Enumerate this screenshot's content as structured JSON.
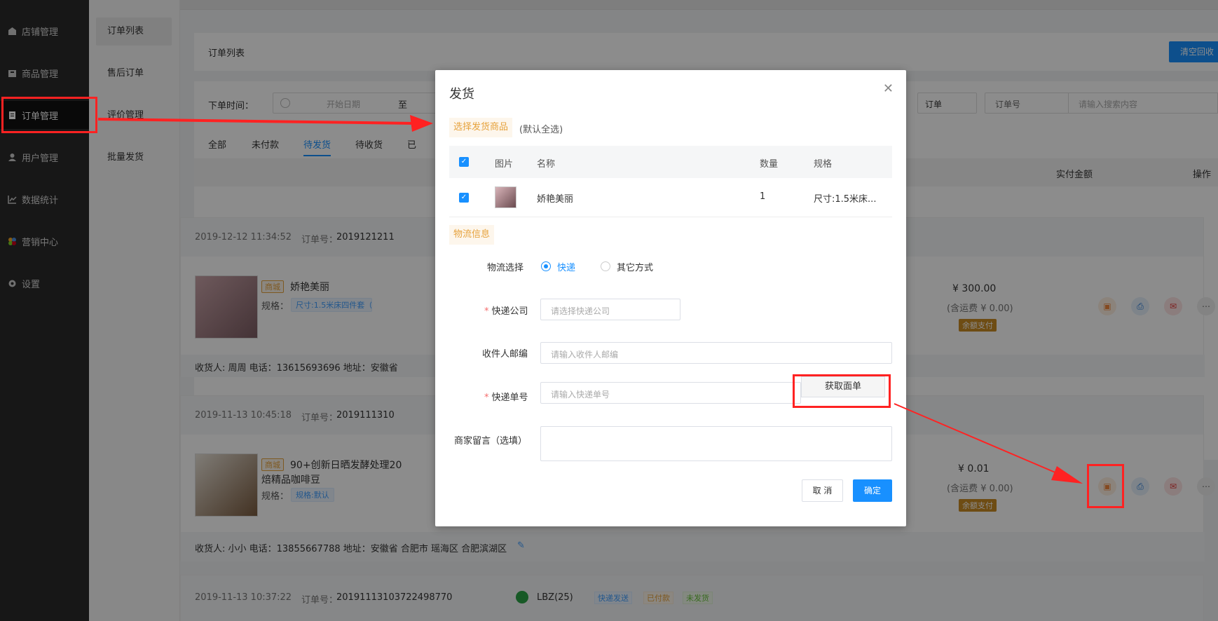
{
  "sidebar": {
    "items": [
      {
        "label": "店铺管理",
        "icon": "store-icon"
      },
      {
        "label": "商品管理",
        "icon": "product-icon"
      },
      {
        "label": "订单管理",
        "icon": "order-icon"
      },
      {
        "label": "用户管理",
        "icon": "user-icon"
      },
      {
        "label": "数据统计",
        "icon": "chart-icon"
      },
      {
        "label": "营销中心",
        "icon": "marketing-icon"
      },
      {
        "label": "设置",
        "icon": "gear-icon"
      }
    ]
  },
  "submenu": {
    "items": [
      "订单列表",
      "售后订单",
      "评价管理",
      "批量发货"
    ]
  },
  "main": {
    "page_title": "订单列表",
    "clear_button": "清空回收",
    "filter": {
      "order_time_label": "下单时间：",
      "start_placeholder": "开始日期",
      "to": "至",
      "order_select": "订单",
      "order_no_select": "订单号",
      "search_placeholder": "请输入搜索内容"
    },
    "tabs": [
      "全部",
      "未付款",
      "待发货",
      "待收货",
      "已"
    ],
    "table_headers": {
      "paid": "实付金额",
      "actions": "操作"
    },
    "orders": [
      {
        "time": "2019-12-12 11:34:52",
        "order_no_label": "订单号：",
        "order_no": "2019121211",
        "shop_tag": "商城",
        "title": "娇艳美丽",
        "spec_label": "规格：",
        "spec_value": "尺寸:1.5米床四件套（被套2",
        "price": "¥ 300.00",
        "shipping": "(含运费 ¥ 0.00)",
        "pay_tag": "余额支付",
        "receiver": "收货人: 周周 电话：13615693696 地址：安徽省"
      },
      {
        "time": "2019-11-13 10:45:18",
        "order_no_label": "订单号：",
        "order_no": "2019111310",
        "shop_tag": "商城",
        "title": "90+创新日晒发酵处理20",
        "title2": "焙精品咖啡豆",
        "spec_label": "规格：",
        "spec_value": "规格:默认",
        "price": "¥ 0.01",
        "shipping": "(含运费 ¥ 0.00)",
        "pay_tag": "余额支付",
        "receiver": "收货人: 小小 电话：13855667788 地址：安徽省 合肥市 瑶海区 合肥滨湖区"
      },
      {
        "time": "2019-11-13 10:37:22",
        "order_no_label": "订单号：",
        "order_no": "20191113103722498770",
        "buyer": "LBZ(25)",
        "tags": [
          "快递发送",
          "已付款",
          "未发货"
        ]
      }
    ]
  },
  "modal": {
    "title": "发货",
    "section_goods": "选择发货商品",
    "section_goods_note": "(默认全选)",
    "goods_headers": {
      "image": "图片",
      "name": "名称",
      "qty": "数量",
      "spec": "规格"
    },
    "goods": [
      {
        "name": "娇艳美丽",
        "qty": "1",
        "spec": "尺寸:1.5米床..."
      }
    ],
    "section_logistics": "物流信息",
    "logistics_label": "物流选择",
    "logistics_options": [
      "快递",
      "其它方式"
    ],
    "company_label": "快递公司",
    "company_placeholder": "请选择快递公司",
    "zip_label": "收件人邮编",
    "zip_placeholder": "请输入收件人邮编",
    "tracking_label": "快递单号",
    "tracking_placeholder": "请输入快递单号",
    "get_waybill_button": "获取面单",
    "note_label": "商家留言（选填）",
    "cancel_button": "取 消",
    "ok_button": "确定"
  },
  "colors": {
    "primary": "#1890ff",
    "annotation": "#ff2222",
    "sidebar": "#2b2b2b",
    "warning": "#e6a23c"
  }
}
